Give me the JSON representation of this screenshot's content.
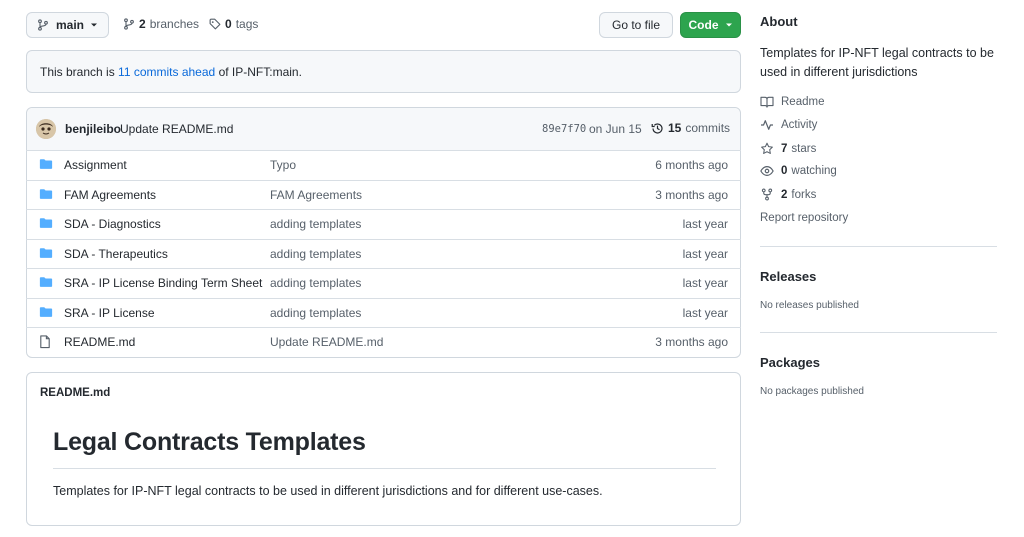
{
  "toolbar": {
    "branch_name": "main",
    "branches_count": "2",
    "branches_label": "branches",
    "tags_count": "0",
    "tags_label": "tags",
    "go_to_file": "Go to file",
    "code_label": "Code"
  },
  "ahead_notice": {
    "prefix": "This branch is",
    "link": "11 commits ahead",
    "suffix": "of IP-NFT:main."
  },
  "latest_commit": {
    "author": "benjileibo",
    "message": "Update README.md",
    "sha": "89e7f70",
    "date": "on Jun 15",
    "commits_count": "15",
    "commits_label": "commits"
  },
  "files": [
    {
      "name": "Assignment",
      "message": "Typo",
      "age": "6 months ago",
      "icon": "folder-icon"
    },
    {
      "name": "FAM Agreements",
      "message": "FAM Agreements",
      "age": "3 months ago",
      "icon": "folder-icon"
    },
    {
      "name": "SDA - Diagnostics",
      "message": "adding templates",
      "age": "last year",
      "icon": "folder-icon"
    },
    {
      "name": "SDA - Therapeutics",
      "message": "adding templates",
      "age": "last year",
      "icon": "folder-icon"
    },
    {
      "name": "SRA - IP License Binding Term Sheet",
      "message": "adding templates",
      "age": "last year",
      "icon": "folder-icon"
    },
    {
      "name": "SRA - IP License",
      "message": "adding templates",
      "age": "last year",
      "icon": "folder-icon"
    },
    {
      "name": "README.md",
      "message": "Update README.md",
      "age": "3 months ago",
      "icon": "file-icon"
    }
  ],
  "readme": {
    "filename": "README.md",
    "heading": "Legal Contracts Templates",
    "body": "Templates for IP-NFT legal contracts to be used in different jurisdictions and for different use-cases."
  },
  "about": {
    "title": "About",
    "description": "Templates for IP-NFT legal contracts to be used in different jurisdictions",
    "readme_label": "Readme",
    "activity_label": "Activity",
    "stars_count": "7",
    "stars_label": "stars",
    "watching_count": "0",
    "watching_label": "watching",
    "forks_count": "2",
    "forks_label": "forks",
    "report_label": "Report repository"
  },
  "releases": {
    "title": "Releases",
    "note": "No releases published"
  },
  "packages": {
    "title": "Packages",
    "note": "No packages published"
  },
  "colors": {
    "accent": "#0969da",
    "green": "#2da44e",
    "folder": "#54aeff",
    "muted": "#57606a"
  }
}
